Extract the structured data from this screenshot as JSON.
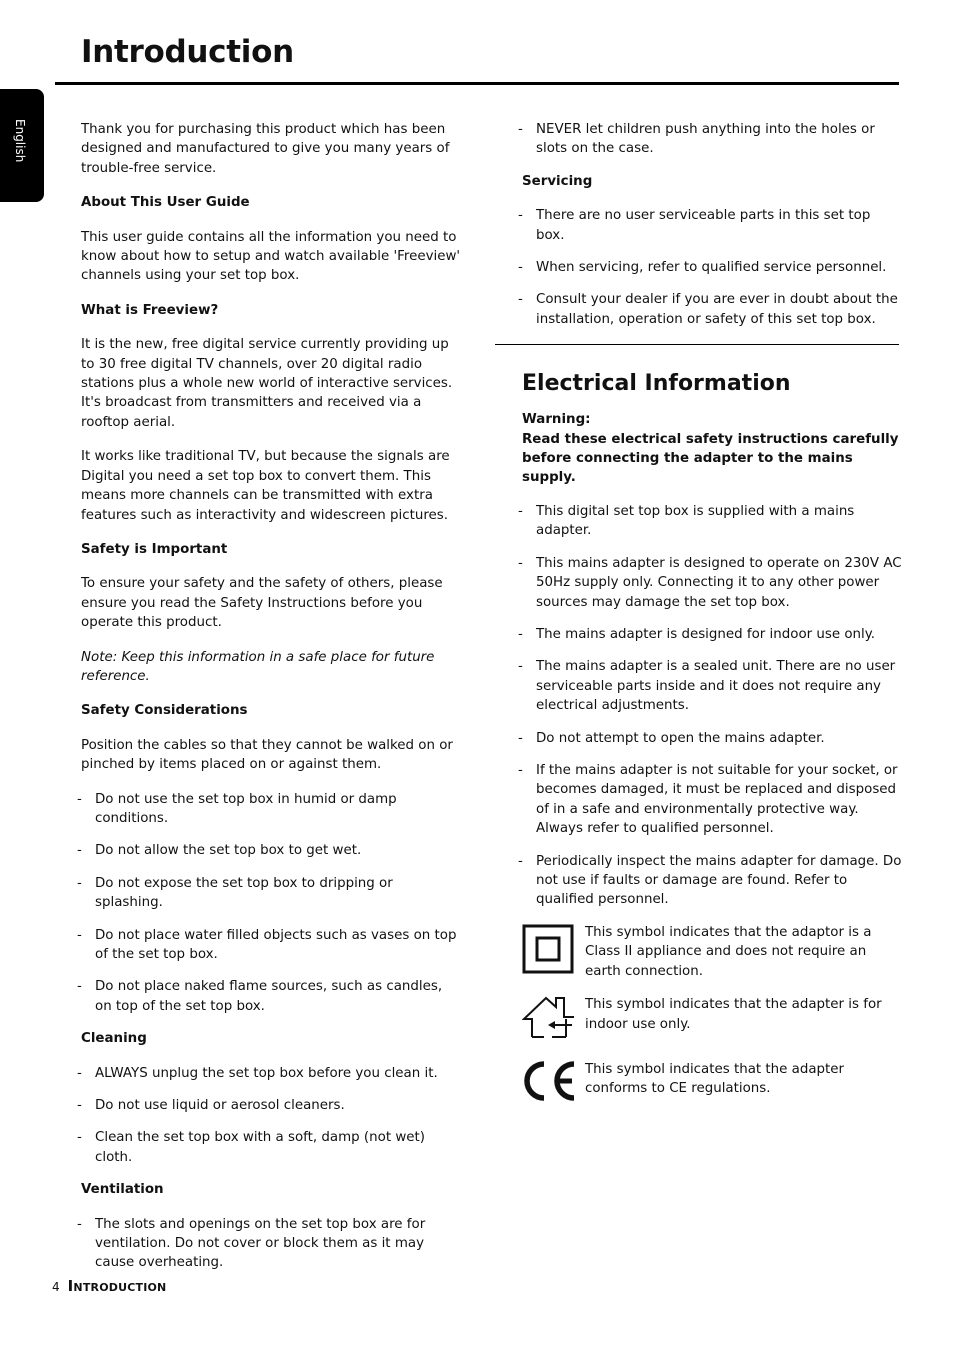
{
  "header": {
    "title": "Introduction",
    "language_tab": "English"
  },
  "left": {
    "intro": "Thank you for purchasing this product which has been designed and manufactured to give you many years of trouble-free service.",
    "about_heading": "About This User Guide",
    "about_text": "This user guide contains all the information you need to know about how to setup and watch available 'Freeview' channels using your set top box.",
    "freeview_heading": "What is Freeview?",
    "freeview_p1": "It is the new, free digital service currently providing up to 30 free digital TV channels, over 20 digital radio stations plus a whole new world of interactive services. It's broadcast from transmitters and received via a rooftop aerial.",
    "freeview_p2": "It works like traditional TV, but because the signals are Digital you need a set top box to convert them. This means more channels can be transmitted with extra features such as interactivity and widescreen pictures.",
    "safety_heading": "Safety is Important",
    "safety_text": "To ensure your safety and the safety of others, please ensure you read the Safety Instructions before you operate this product.",
    "note": "Note: Keep this information in a safe place for future reference.",
    "considerations_heading": "Safety Considerations",
    "considerations_text": "Position the cables so that they cannot be walked on or pinched by items placed on or against them.",
    "considerations_items": [
      "Do not use the set top box in humid or damp conditions.",
      "Do not allow the set top box to get wet.",
      "Do not expose the set top box to dripping or splashing.",
      "Do not place water filled objects such as vases on top of the set top box.",
      "Do not place naked flame sources, such as candles, on top of the set top box."
    ],
    "cleaning_heading": "Cleaning",
    "cleaning_items": [
      "ALWAYS unplug the set top box before you clean it.",
      "Do not use liquid or aerosol cleaners.",
      "Clean the set top box with a soft, damp (not wet) cloth."
    ],
    "ventilation_heading": "Ventilation",
    "ventilation_items": [
      "The slots and openings on the set top box are for ventilation. Do not cover or block them as it may cause overheating."
    ]
  },
  "right": {
    "top_items": [
      "NEVER let children push anything into the holes or slots on the case."
    ],
    "servicing_heading": "Servicing",
    "servicing_items": [
      "There are no user serviceable parts in this set top box.",
      "When servicing, refer to qualified service personnel.",
      "Consult your dealer if you are ever in doubt about the installation, operation or safety of this set top box."
    ],
    "electrical_heading": "Electrical Information",
    "warning_label": "Warning:",
    "warning_text": "Read these electrical safety instructions carefully before connecting the adapter to the mains supply.",
    "electrical_items": [
      "This digital set top box is supplied with a mains adapter.",
      "This mains adapter is designed to operate on 230V AC 50Hz supply only. Connecting it to any other power sources may damage the set top box.",
      "The mains adapter is designed for indoor use only.",
      "The mains adapter is a sealed unit. There are no user serviceable parts inside and it does not require any electrical adjustments.",
      "Do not attempt to open the mains adapter.",
      "If the mains adapter is not suitable for your socket, or becomes damaged, it must be replaced and disposed of in a safe and environmentally protective way. Always refer to qualified personnel.",
      "Periodically inspect the mains adapter for damage. Do not use if faults or damage are found. Refer to qualified personnel."
    ],
    "symbols": [
      {
        "icon": "class-ii-double-square-icon",
        "text": "This symbol indicates that the adaptor is a Class II appliance and does not require an earth connection."
      },
      {
        "icon": "indoor-use-house-icon",
        "text": "This symbol indicates that the adapter is for indoor use only."
      },
      {
        "icon": "ce-mark-icon",
        "text": "This symbol indicates that the adapter conforms to CE regulations."
      }
    ]
  },
  "footer": {
    "page_number": "4",
    "section": "Introduction"
  }
}
